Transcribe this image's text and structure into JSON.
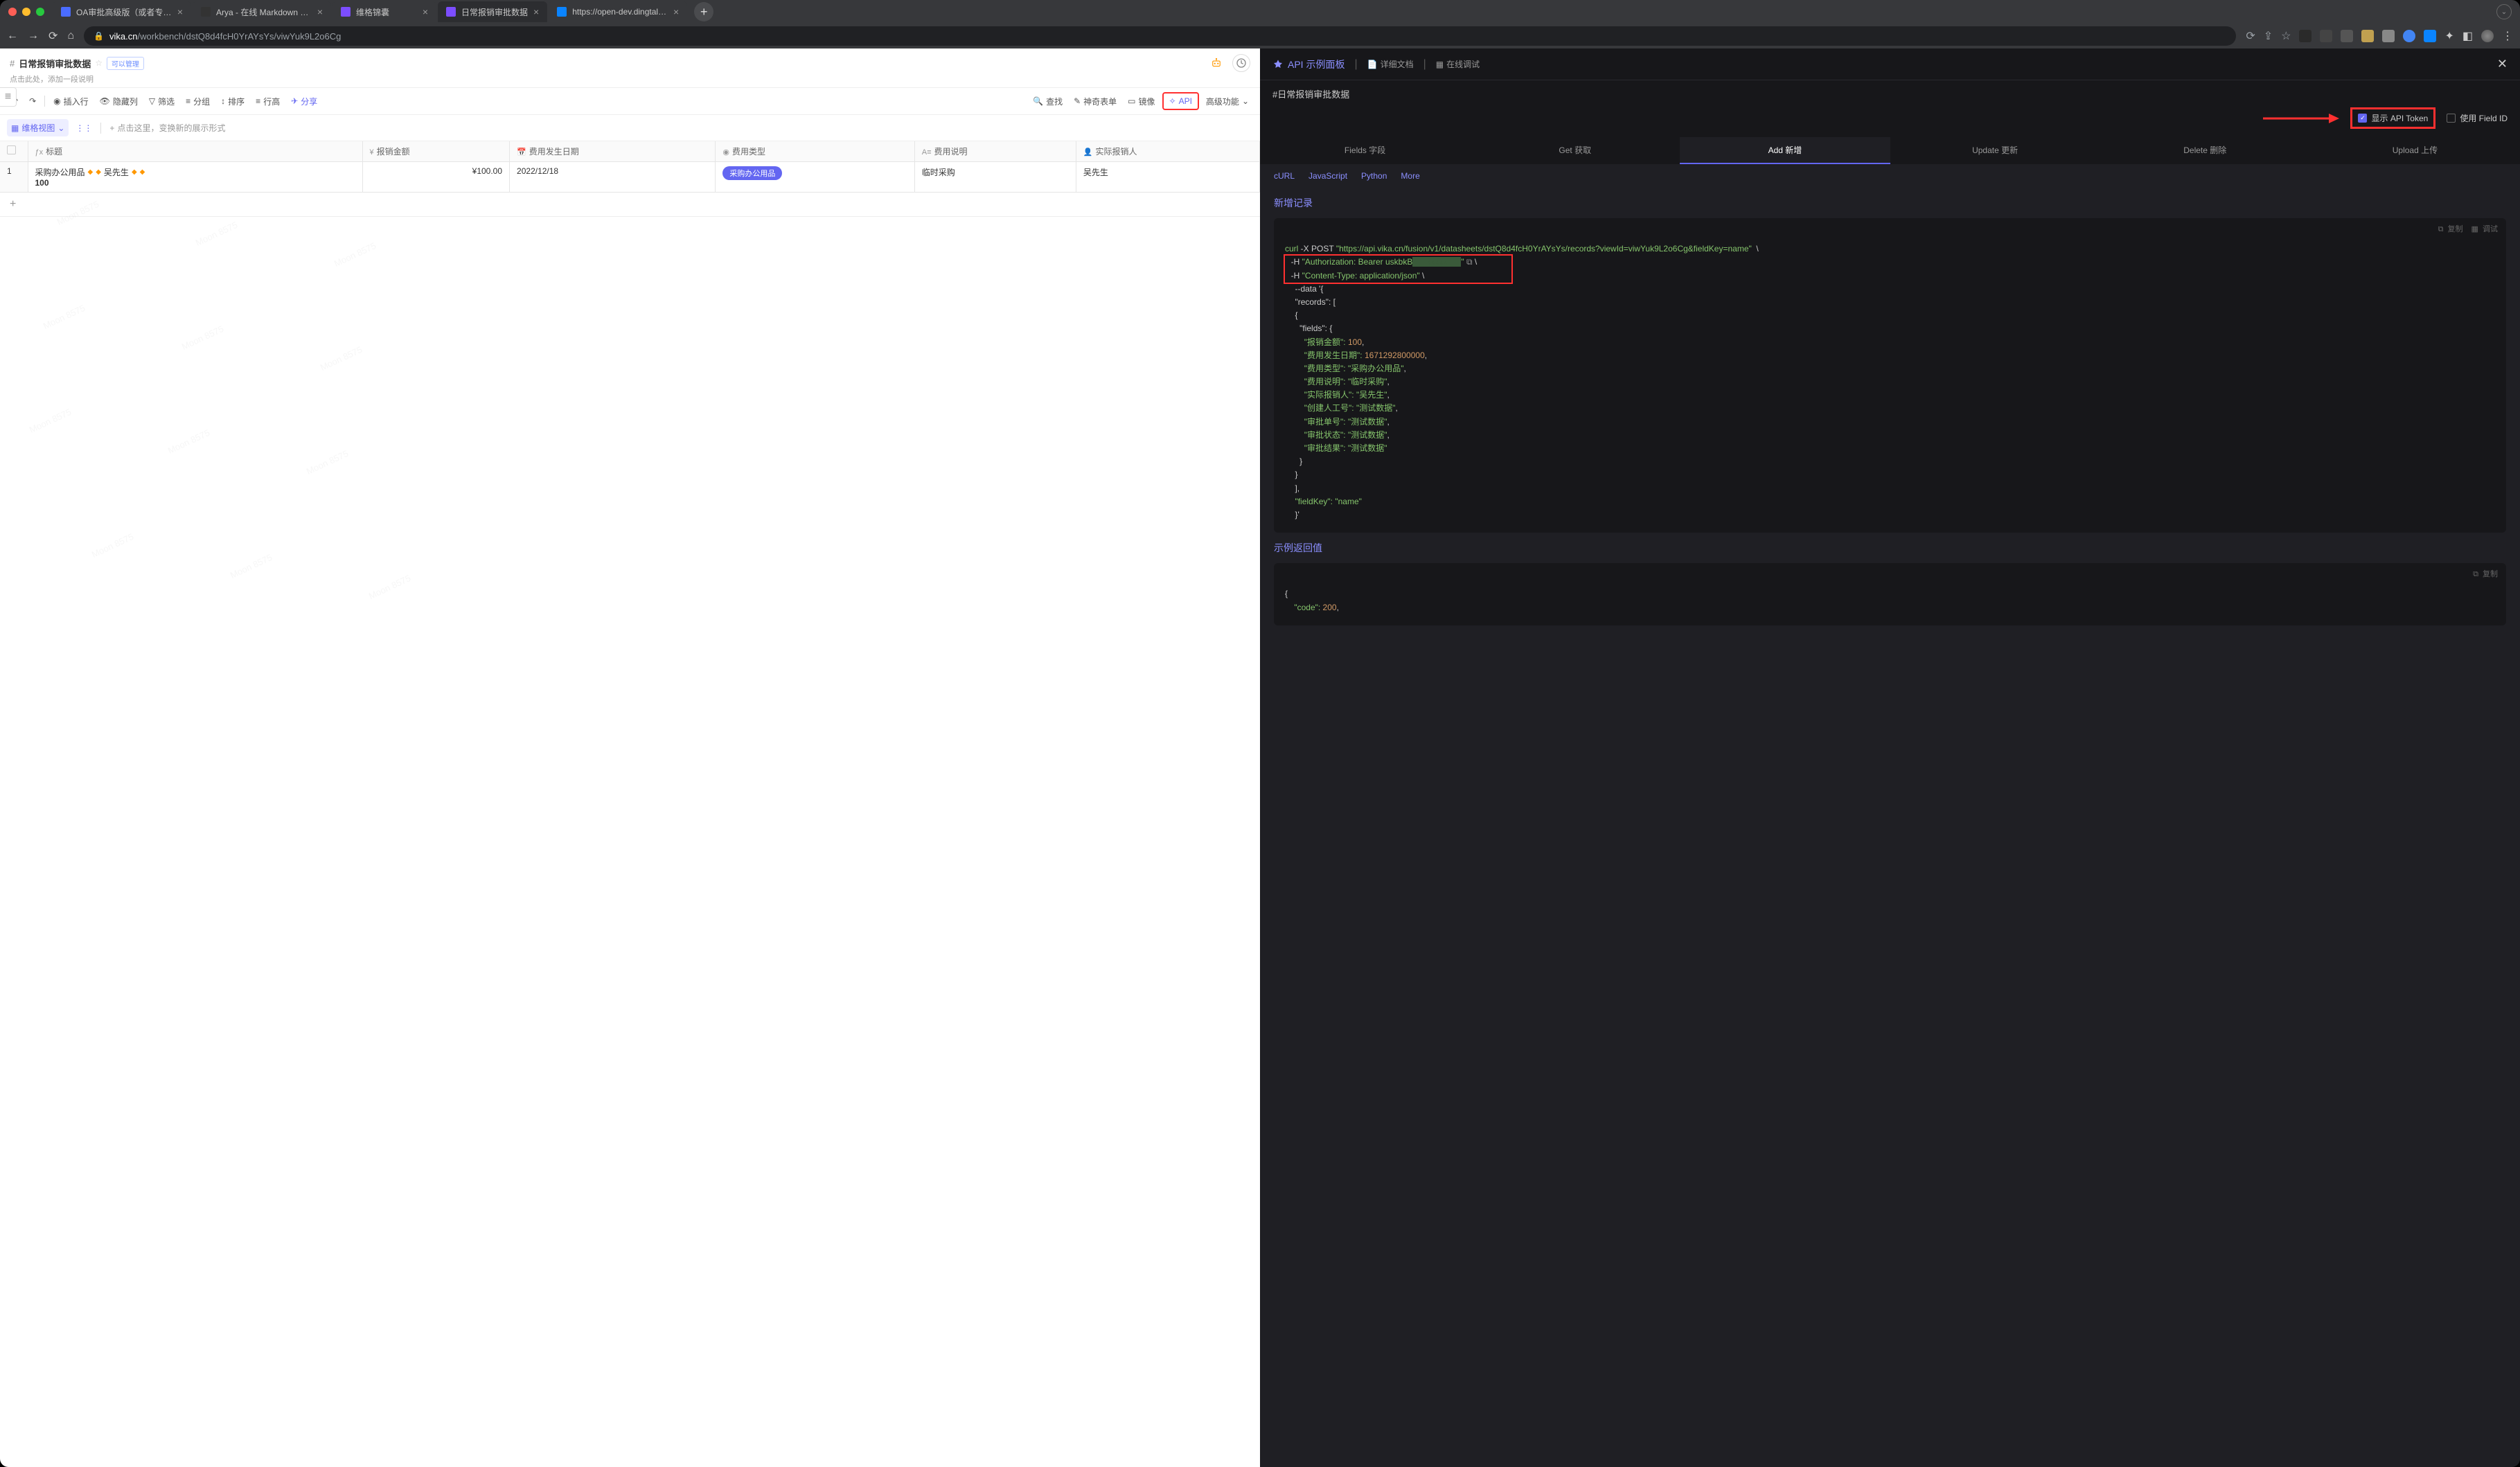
{
  "browser": {
    "tabs": [
      {
        "title": "OA审批高级版（或者专业版钉",
        "favicon": "#4a6cff"
      },
      {
        "title": "Arya - 在线 Markdown 编辑器",
        "favicon": "#333"
      },
      {
        "title": "维格锦囊",
        "favicon": "#7c4dff"
      },
      {
        "title": "日常报销审批数据",
        "favicon": "#7c4dff"
      },
      {
        "title": "https://open-dev.dingtalk.com",
        "favicon": "#0a84ff"
      }
    ],
    "url_domain": "vika.cn",
    "url_path": "/workbench/dstQ8d4fcH0YrAYsYs/viwYuk9L2o6Cg"
  },
  "vika": {
    "title": "日常报销审批数据",
    "manage_badge": "可以管理",
    "subtitle_placeholder": "点击此处，添加一段说明",
    "toolbar": {
      "view": "维格视图",
      "insert_row": "插入行",
      "hidden_cols": "隐藏列",
      "filter": "筛选",
      "group": "分组",
      "sort": "排序",
      "row_height": "行高",
      "share": "分享",
      "hint": "点击这里，变换新的展示形式",
      "search": "查找",
      "magic_form": "神奇表单",
      "mirror": "镜像",
      "api": "API",
      "advanced": "高级功能"
    },
    "columns": {
      "title": "标题",
      "amount": "报销金额",
      "date": "费用发生日期",
      "type": "费用类型",
      "desc": "费用说明",
      "person": "实际报销人"
    },
    "row": {
      "num": "1",
      "title_text": "采购办公用品",
      "title_person": "吴先生",
      "title_suffix": "100",
      "amount": "¥100.00",
      "date": "2022/12/18",
      "type_pill": "采购办公用品",
      "desc": "临时采购",
      "person": "吴先生"
    }
  },
  "api": {
    "header_title": "API 示例面板",
    "doc_link": "详细文档",
    "debug_link": "在线调试",
    "breadcrumb": "#日常报销审批数据",
    "cb_token": "显示 API Token",
    "cb_fieldid": "使用 Field ID",
    "tabs": {
      "fields": "Fields 字段",
      "get": "Get 获取",
      "add": "Add 新增",
      "update": "Update 更新",
      "delete": "Delete 删除",
      "upload": "Upload 上传"
    },
    "subtabs": {
      "curl": "cURL",
      "js": "JavaScript",
      "python": "Python",
      "more": "More"
    },
    "section1": "新增记录",
    "code_copy": "复制",
    "code_debug": "调试",
    "code": {
      "l1a": "curl",
      "l1b": " -X POST ",
      "l1c": "\"https://api.vika.cn/fusion/v1/datasheets/dstQ8d4fcH0YrAYsYs/records?viewId=viwYuk9L2o6Cg&fieldKey=name\"",
      "l1d": "  \\",
      "l2a": "-H ",
      "l2b": "\"Authorization: Bearer uskbkB",
      "l2d": " \\",
      "l3a": "-H ",
      "l3b": "\"Content-Type: application/json\"",
      "l3c": " \\",
      "l4": "--data '{",
      "l5": "\"records\": [",
      "l6": "{",
      "l7": "  \"fields\": {",
      "l8a": "    \"报销金额\": ",
      "l8b": "100",
      "l8c": ",",
      "l9a": "    \"费用发生日期\": ",
      "l9b": "1671292800000",
      "l9c": ",",
      "l10a": "    \"费用类型\": ",
      "l10b": "\"采购办公用品\"",
      "l10c": ",",
      "l11a": "    \"费用说明\": ",
      "l11b": "\"临时采购\"",
      "l11c": ",",
      "l12a": "    \"实际报销人\": ",
      "l12b": "\"吴先生\"",
      "l12c": ",",
      "l13a": "    \"创建人工号\": ",
      "l13b": "\"测试数据\"",
      "l13c": ",",
      "l14a": "    \"审批单号\": ",
      "l14b": "\"测试数据\"",
      "l14c": ",",
      "l15a": "    \"审批状态\": ",
      "l15b": "\"测试数据\"",
      "l15c": ",",
      "l16a": "    \"审批结果\": ",
      "l16b": "\"测试数据\"",
      "l17": "  }",
      "l18": "}",
      "l19": "],",
      "l20a": "\"fieldKey\": ",
      "l20b": "\"name\"",
      "l21": "}'"
    },
    "section2": "示例返回值",
    "code2": {
      "l1": "{",
      "l2a": "    \"code\": ",
      "l2b": "200",
      "l2c": ","
    }
  },
  "watermark": "Moon 8575"
}
